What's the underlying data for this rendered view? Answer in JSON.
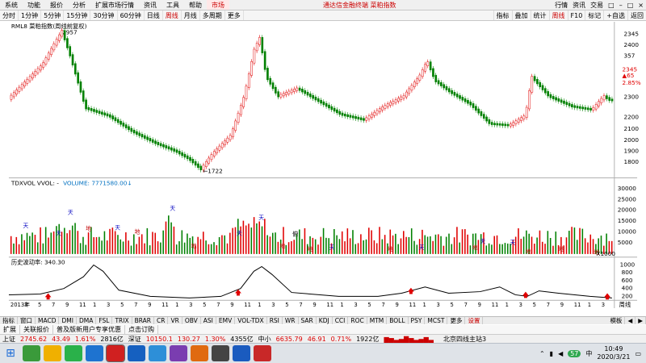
{
  "menubar": {
    "items": [
      "系统",
      "功能",
      "报价",
      "分析",
      "扩展市场行情",
      "资讯",
      "工具",
      "帮助"
    ],
    "active": "市场",
    "center_title": "通达信金融终端 菜粕指数",
    "right": [
      "行情",
      "资讯",
      "交易",
      "□",
      "–",
      "□",
      "×"
    ]
  },
  "toolbar": {
    "items": [
      "分时",
      "1分钟",
      "5分钟",
      "15分钟",
      "30分钟",
      "60分钟",
      "日线",
      "周线",
      "月线",
      "多周期",
      "更多"
    ],
    "active": "周线",
    "right": [
      "指标",
      "叠加",
      "统计",
      "周线",
      "F10",
      "标记",
      "+自选",
      "返回"
    ],
    "right_active": "周线"
  },
  "price_panel": {
    "label": "RML8 菜粕指数(周线前复权)",
    "high_label": "2957",
    "low_label": "←1722",
    "axis": [
      "2345",
      "2400",
      "2344",
      "357",
      "2300",
      "2345",
      "▲65",
      "2.85%",
      "2200",
      "2100",
      "2000",
      "1900",
      "1800"
    ],
    "axis_red": [
      "2345",
      "▲65",
      "2.85%"
    ]
  },
  "volume_panel": {
    "label": "TDXVOL VVOL: -",
    "value": "VOLUME: 7771580.00↓",
    "axis": [
      "30000",
      "25000",
      "20000",
      "15000",
      "10000",
      "5000"
    ],
    "unit": "X1000",
    "markers": [
      "天",
      "地"
    ],
    "mark_label": "俯"
  },
  "hv_panel": {
    "label": "历史波动率: 340.30",
    "axis": [
      "1000",
      "800",
      "600",
      "400",
      "200"
    ],
    "x_axis": [
      "2013年",
      "3",
      "5",
      "7",
      "9",
      "11",
      "1",
      "3",
      "5",
      "7",
      "9",
      "11",
      "1",
      "3",
      "5",
      "7",
      "9",
      "11",
      "1",
      "3",
      "5",
      "7",
      "9",
      "11",
      "1",
      "3",
      "5",
      "7",
      "9",
      "11",
      "1",
      "3",
      "5",
      "7",
      "9",
      "11",
      "1",
      "3",
      "5",
      "7",
      "9",
      "11",
      "1",
      "3"
    ],
    "x_end": "周线"
  },
  "indicators": {
    "items": [
      "指标",
      "窗口",
      "MACD",
      "DMI",
      "DMA",
      "FSL",
      "TRIX",
      "BRAR",
      "CR",
      "VR",
      "OBV",
      "ASI",
      "EMV",
      "VOL-TDX",
      "RSI",
      "WR",
      "SAR",
      "KDJ",
      "CCI",
      "ROC",
      "MTM",
      "BOLL",
      "PSY",
      "MCST",
      "更多",
      "设置"
    ],
    "active": "设置",
    "right": [
      "模板",
      "◀",
      "▶"
    ]
  },
  "funcbar": {
    "items": [
      "扩展",
      "关联报价",
      "普及版新用户专享优惠",
      "点击订购"
    ]
  },
  "status": {
    "sh_name": "上证",
    "sh_val": "2745.62",
    "sh_chg": "43.49",
    "sh_pct": "1.61%",
    "sh_amt": "2816亿",
    "sz_name": "深证",
    "sz_val": "10150.1",
    "sz_chg": "130.27",
    "sz_pct": "1.30%",
    "sz_amt": "4355亿",
    "zx_name": "中小",
    "zx_val": "6635.79",
    "zx_chg": "46.91",
    "zx_pct": "0.71%",
    "zx_amt": "1922亿",
    "server": "北京四线主站3"
  },
  "taskbar": {
    "time": "10:49",
    "date": "2020/3/21",
    "badge": "57"
  },
  "colors": {
    "up": "#e00000",
    "down": "#008000",
    "line": "#000000",
    "menu_red": "#cc0000"
  }
}
